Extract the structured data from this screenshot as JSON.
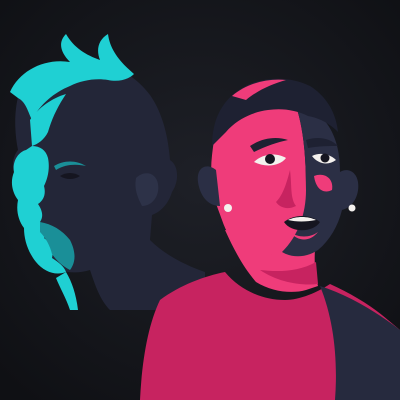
{
  "image": {
    "kind": "illustration",
    "subject": "two-portraits",
    "colors": {
      "background": "#1a1c22",
      "background_vignette": "#0f1014",
      "shadow_navy": "#262a3e",
      "shadow_navy_dark": "#1e2132",
      "teal_rim": "#1fd0d3",
      "teal_bright": "#5bf2ef",
      "pink_light": "#ef3c7a",
      "pink_dark": "#c72360",
      "eye_white": "#f4f1ee",
      "pupil": "#151520"
    }
  }
}
